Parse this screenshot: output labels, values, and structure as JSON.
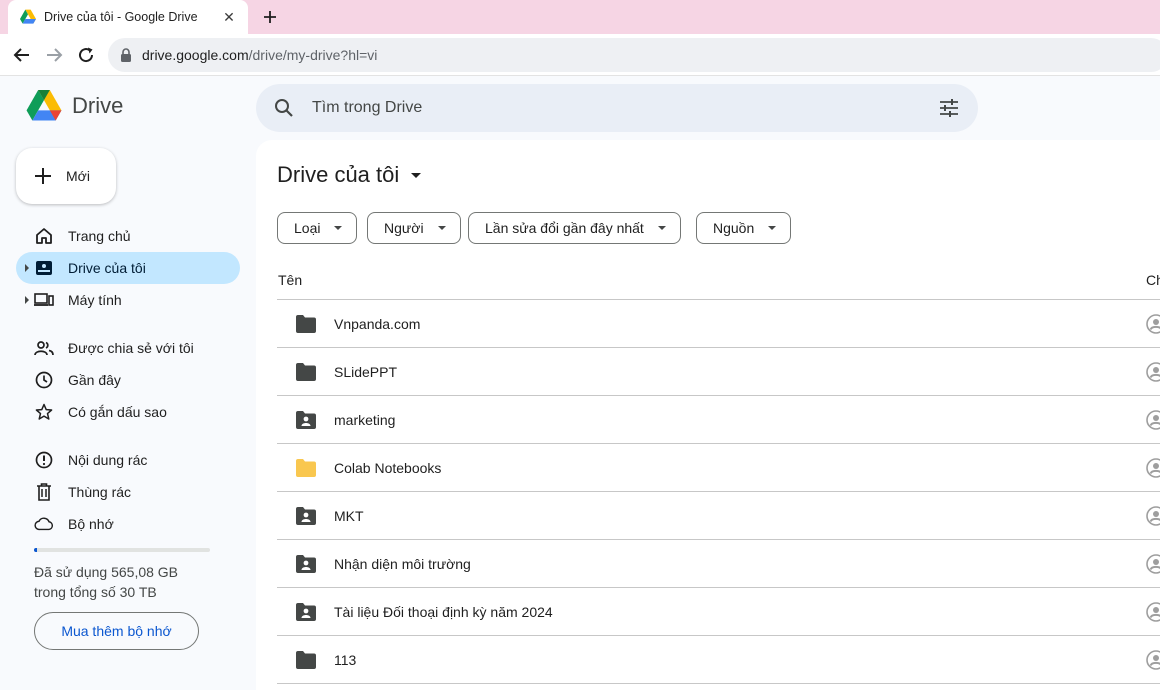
{
  "browser": {
    "tab_title": "Drive của tôi - Google Drive",
    "url_host": "drive.google.com",
    "url_path": "/drive/my-drive?hl=vi"
  },
  "header": {
    "brand": "Drive",
    "search_placeholder": "Tìm trong Drive"
  },
  "sidebar": {
    "new_label": "Mới",
    "items": [
      {
        "label": "Trang chủ",
        "icon": "home-icon"
      },
      {
        "label": "Drive của tôi",
        "icon": "my-drive-icon",
        "active": true
      },
      {
        "label": "Máy tính",
        "icon": "computers-icon"
      },
      {
        "label": "Được chia sẻ với tôi",
        "icon": "shared-icon"
      },
      {
        "label": "Gần đây",
        "icon": "clock-icon"
      },
      {
        "label": "Có gắn dấu sao",
        "icon": "star-icon"
      },
      {
        "label": "Nội dung rác",
        "icon": "spam-icon"
      },
      {
        "label": "Thùng rác",
        "icon": "trash-icon"
      },
      {
        "label": "Bộ nhớ",
        "icon": "cloud-icon"
      }
    ],
    "storage": {
      "used_fraction": 0.018,
      "line1": "Đã sử dụng 565,08 GB",
      "line2": "trong tổng số 30 TB",
      "buy_label": "Mua thêm bộ nhớ"
    }
  },
  "main": {
    "title": "Drive của tôi",
    "filters": [
      "Loại",
      "Người",
      "Lần sửa đổi gần đây nhất",
      "Nguồn"
    ],
    "columns": {
      "name": "Tên",
      "owner": "Ch"
    },
    "files": [
      {
        "name": "Vnpanda.com",
        "type": "folder"
      },
      {
        "name": "SLidePPT",
        "type": "folder"
      },
      {
        "name": "marketing",
        "type": "shared-folder"
      },
      {
        "name": "Colab Notebooks",
        "type": "yellow-folder"
      },
      {
        "name": "MKT",
        "type": "shared-folder"
      },
      {
        "name": "Nhận diện môi trường",
        "type": "shared-folder"
      },
      {
        "name": "Tài liệu Đối thoại định kỳ năm 2024",
        "type": "shared-folder"
      },
      {
        "name": "113",
        "type": "folder"
      }
    ]
  },
  "colors": {
    "accent": "#0b57d0",
    "active_nav": "#c2e7ff",
    "tab_strip": "#f6d5e4"
  }
}
